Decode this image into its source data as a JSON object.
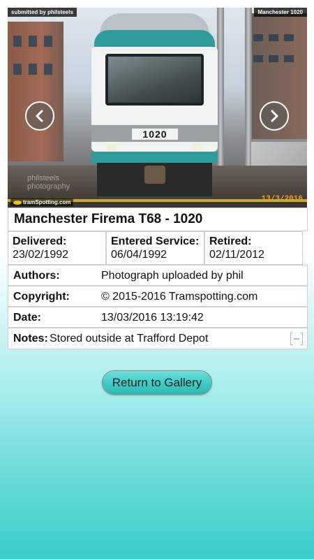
{
  "photo": {
    "submitted_by": "submitted by philsteels",
    "location": "Manchester 1020",
    "watermark": "tramSpotting.com",
    "credit_line1": "philsteels",
    "credit_line2": "photography",
    "fleet_number": "1020",
    "date_stamp": "13/3/2016"
  },
  "title": "Manchester Firema T68 - 1020",
  "dates": {
    "delivered_label": "Delivered:",
    "delivered_value": "23/02/1992",
    "entered_label": "Entered Service:",
    "entered_value": "06/04/1992",
    "retired_label": "Retired:",
    "retired_value": "02/11/2012"
  },
  "details": {
    "authors_label": "Authors:",
    "authors_value": "Photograph uploaded by phil",
    "copyright_label": "Copyright:",
    "copyright_value": "© 2015-2016 Tramspotting.com",
    "date_label": "Date:",
    "date_value": "13/03/2016 13:19:42",
    "notes_label": "Notes:",
    "notes_value": "Stored outside at Trafford Depot"
  },
  "actions": {
    "return_label": "Return to Gallery"
  },
  "colors": {
    "accent": "#3dcbc6",
    "background_bottom": "#3ccccb"
  },
  "icons": {
    "prev": "chevron-left-icon",
    "next": "chevron-right-icon",
    "collapse": "collapse-icon"
  }
}
